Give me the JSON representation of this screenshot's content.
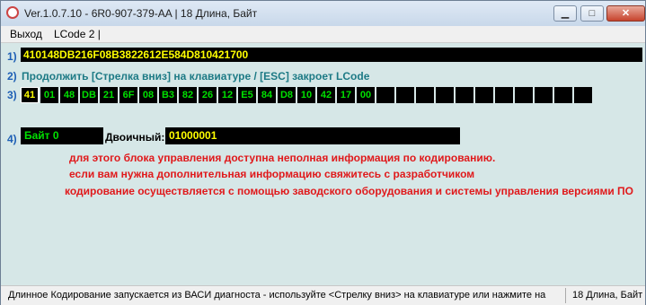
{
  "window": {
    "title": "Ver.1.0.7.10 -   6R0-907-379-AA | 18 Длина, Байт",
    "minimize": "▁",
    "maximize": "□",
    "close": "✕"
  },
  "menu": {
    "exit": "Выход",
    "lcode": "LCode 2 |"
  },
  "row1": {
    "num": "1)",
    "code": "410148DB216F08B3822612E584D810421700"
  },
  "row2": {
    "num": "2)",
    "text": "Продолжить [Стрелка вниз] на клавиатуре / [ESC] закроет LCode"
  },
  "row3": {
    "num": "3)",
    "bytes": [
      "41",
      "01",
      "48",
      "DB",
      "21",
      "6F",
      "08",
      "B3",
      "82",
      "26",
      "12",
      "E5",
      "84",
      "D8",
      "10",
      "42",
      "17",
      "00",
      "",
      "",
      "",
      "",
      "",
      "",
      "",
      "",
      "",
      "",
      ""
    ]
  },
  "row4": {
    "num": "4)",
    "byte_label": "Байт 0",
    "binary_label": "Двоичный:",
    "binary_value": "01000001"
  },
  "messages": [
    "для этого блока управления доступна неполная информация по кодированию.",
    "если вам нужна дополнительная информацию свяжитесь с разработчиком",
    "кодирование осуществляется с помощью заводского оборудования и системы управления версиями ПО"
  ],
  "status": {
    "left": "Длинное Кодирование  запускается из ВАСИ диагноста - используйте <Стрелку вниз> на клавиатуре или нажмите на",
    "right": "18 Длина, Байт"
  }
}
